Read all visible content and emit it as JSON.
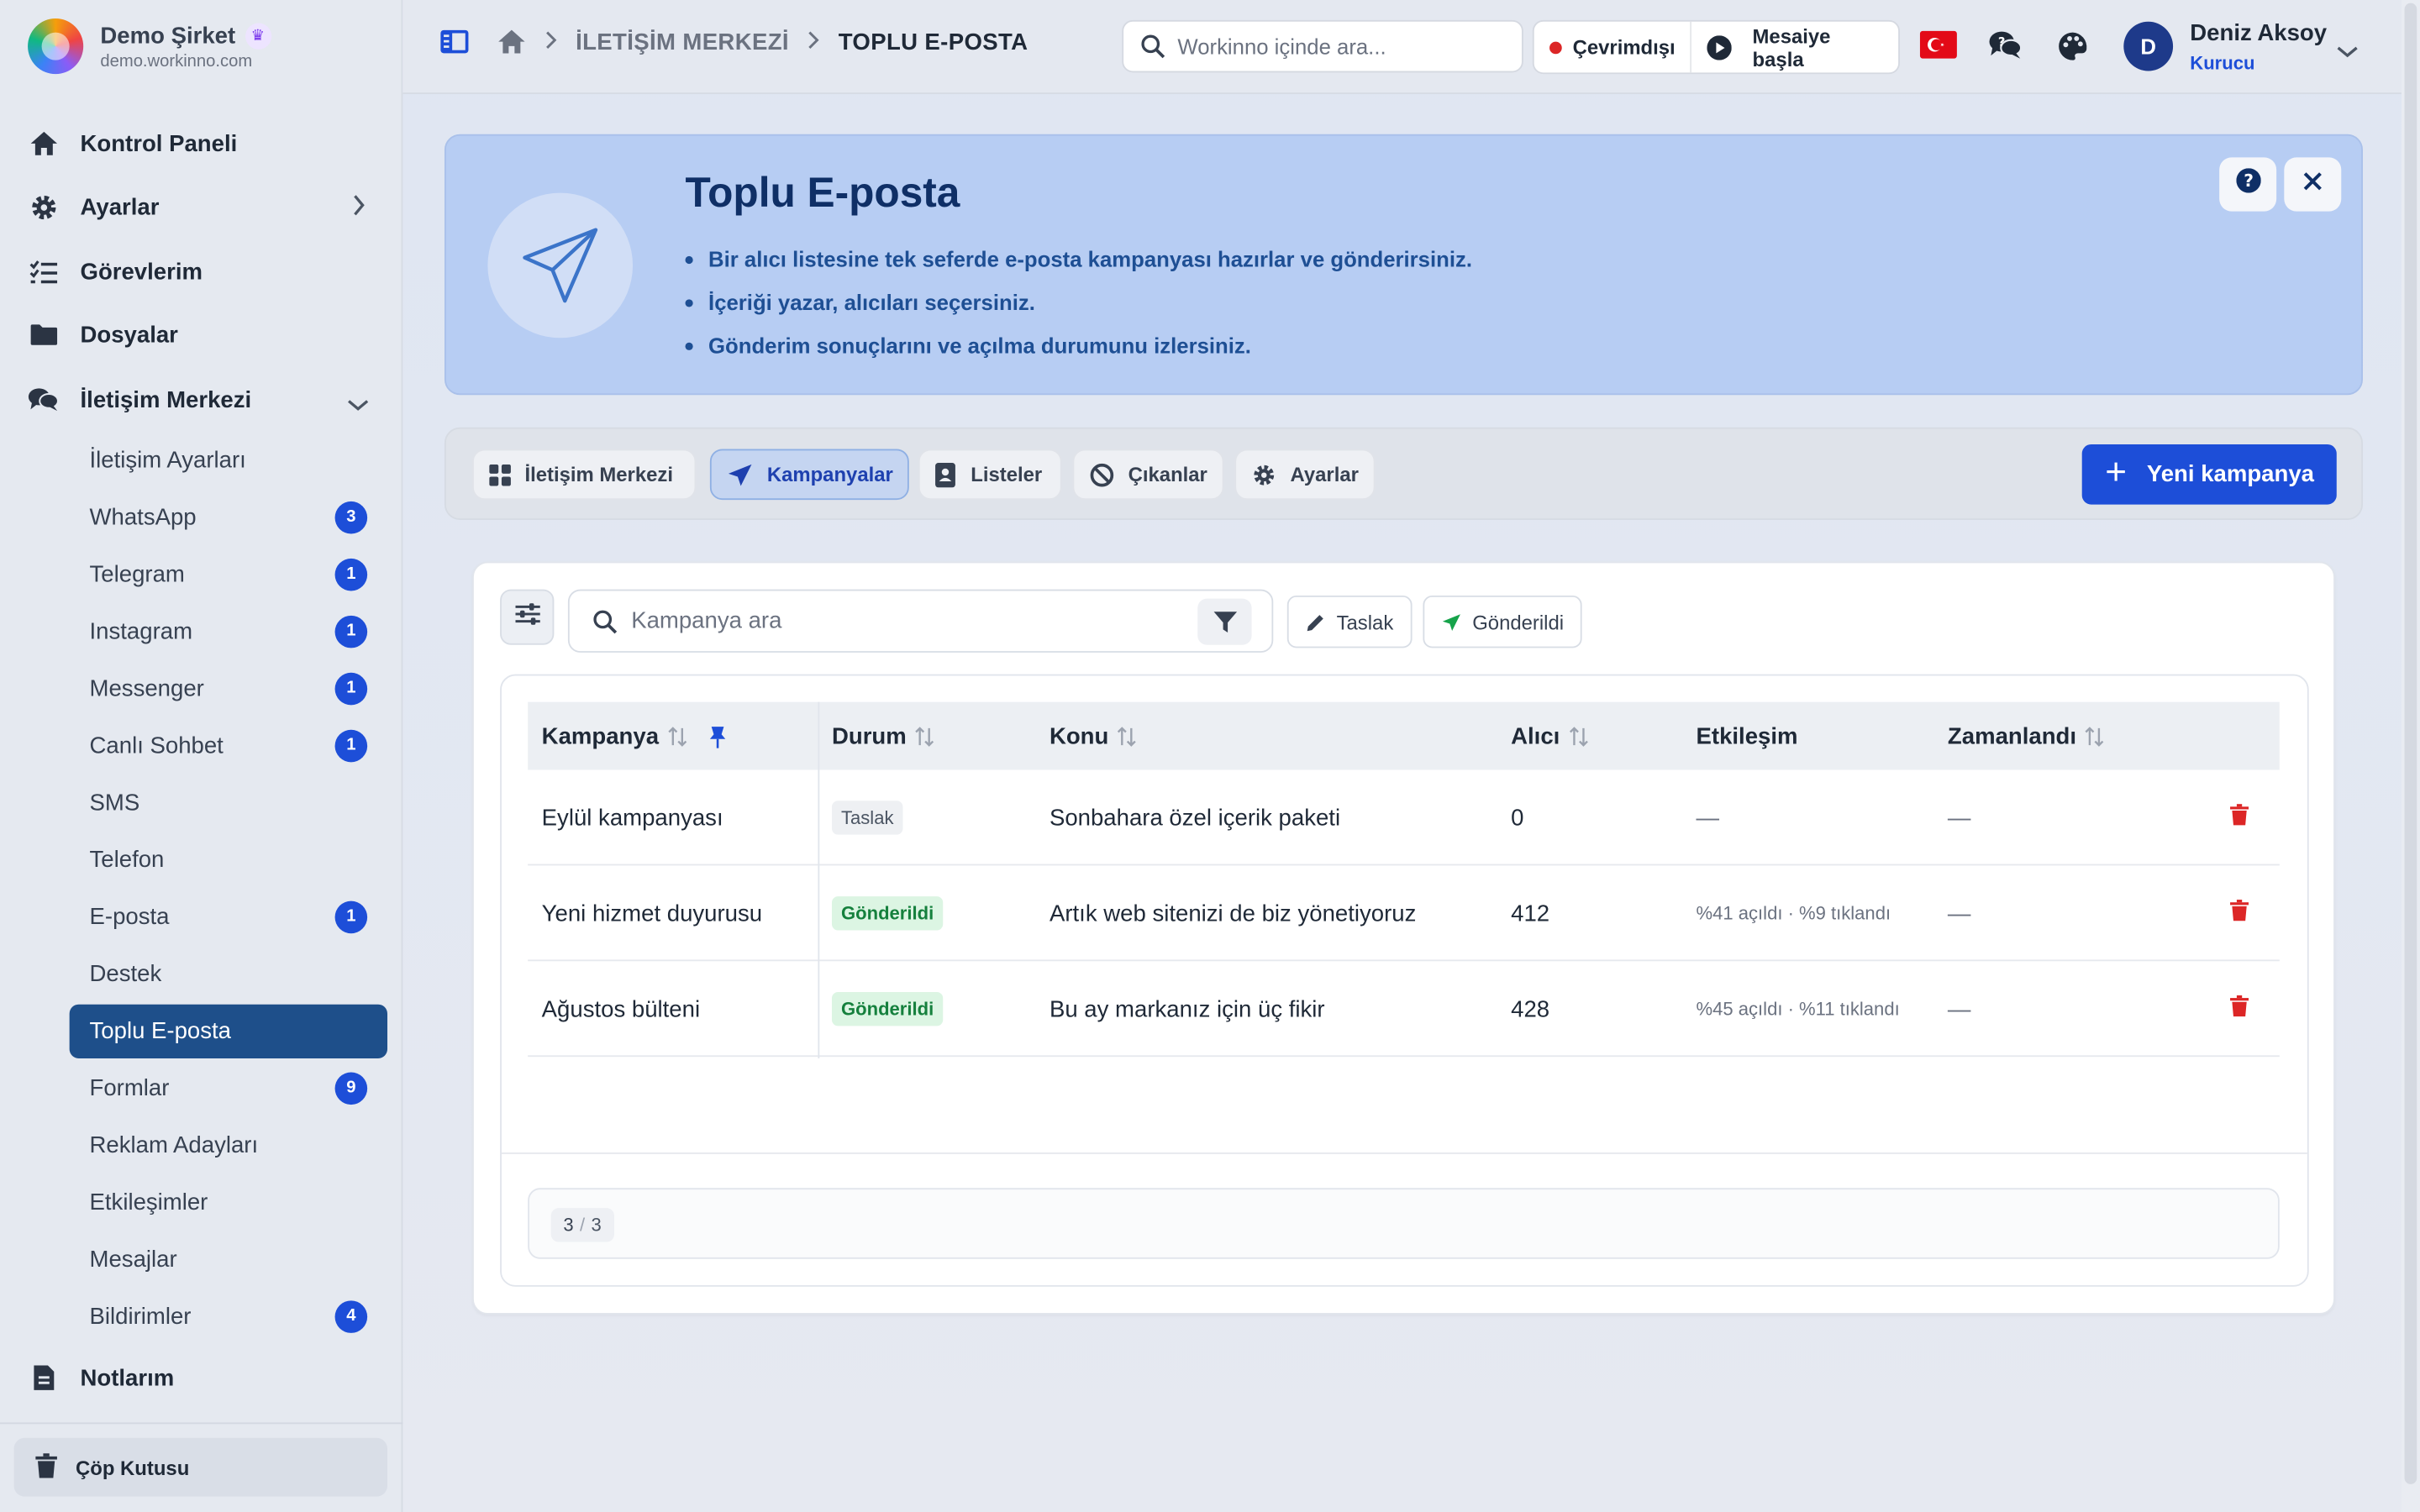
{
  "brand": {
    "name": "Demo Şirket",
    "url": "demo.workinno.com",
    "crown_icon": "crown-icon"
  },
  "sidebar": {
    "main_items": [
      {
        "label": "Kontrol Paneli",
        "icon": "home-icon"
      },
      {
        "label": "Ayarlar",
        "icon": "gear-icon"
      },
      {
        "label": "Görevlerim",
        "icon": "task-list-icon"
      },
      {
        "label": "Dosyalar",
        "icon": "folder-icon"
      },
      {
        "label": "İletişim Merkezi",
        "icon": "chat-icon"
      },
      {
        "label": "Notlarım",
        "icon": "note-icon"
      }
    ],
    "sub_items": [
      {
        "label": "İletişim Ayarları",
        "badge": null
      },
      {
        "label": "WhatsApp",
        "badge": "3"
      },
      {
        "label": "Telegram",
        "badge": "1"
      },
      {
        "label": "Instagram",
        "badge": "1"
      },
      {
        "label": "Messenger",
        "badge": "1"
      },
      {
        "label": "Canlı Sohbet",
        "badge": "1"
      },
      {
        "label": "SMS",
        "badge": null
      },
      {
        "label": "Telefon",
        "badge": null
      },
      {
        "label": "E-posta",
        "badge": "1"
      },
      {
        "label": "Destek",
        "badge": null
      },
      {
        "label": "Toplu E-posta",
        "badge": null,
        "active": true
      },
      {
        "label": "Formlar",
        "badge": "9"
      },
      {
        "label": "Reklam Adayları",
        "badge": null
      },
      {
        "label": "Etkileşimler",
        "badge": null
      },
      {
        "label": "Mesajlar",
        "badge": null
      },
      {
        "label": "Bildirimler",
        "badge": "4"
      }
    ],
    "trash_label": "Çöp Kutusu"
  },
  "topbar": {
    "breadcrumb": [
      "İLETİŞİM MERKEZİ",
      "TOPLU E-POSTA"
    ],
    "search_placeholder": "Workinno içinde ara...",
    "status_label": "Çevrimdışı",
    "shift_label": "Mesaiye başla",
    "user": {
      "initial": "D",
      "name": "Deniz Aksoy",
      "role": "Kurucu"
    }
  },
  "hero": {
    "title": "Toplu E-posta",
    "bullets": [
      "Bir alıcı listesine tek seferde e-posta kampanyası hazırlar ve gönderirsiniz.",
      "İçeriği yazar, alıcıları seçersiniz.",
      "Gönderim sonuçlarını ve açılma durumunu izlersiniz."
    ]
  },
  "tabs": [
    {
      "label": "İletişim Merkezi",
      "icon": "grid-icon"
    },
    {
      "label": "Kampanyalar",
      "icon": "send-icon",
      "active": true
    },
    {
      "label": "Listeler",
      "icon": "contact-book-icon"
    },
    {
      "label": "Çıkanlar",
      "icon": "ban-icon"
    },
    {
      "label": "Ayarlar",
      "icon": "gear-icon"
    }
  ],
  "new_campaign_label": "Yeni kampanya",
  "campaigns": {
    "search_placeholder": "Kampanya ara",
    "chips": [
      "Taslak",
      "Gönderildi"
    ],
    "columns": [
      "Kampanya",
      "Durum",
      "Konu",
      "Alıcı",
      "Etkileşim",
      "Zamanlandı"
    ],
    "rows": [
      {
        "name": "Eylül kampanyası",
        "status": "Taslak",
        "subject": "Sonbahara özel içerik paketi",
        "recipients": "0",
        "engagement": "—",
        "scheduled": "—"
      },
      {
        "name": "Yeni hizmet duyurusu",
        "status": "Gönderildi",
        "subject": "Artık web sitenizi de biz yönetiyoruz",
        "recipients": "412",
        "engagement": "%41 açıldı · %9 tıklandı",
        "scheduled": "—"
      },
      {
        "name": "Ağustos bülteni",
        "status": "Gönderildi",
        "subject": "Bu ay markanız için üç fikir",
        "recipients": "428",
        "engagement": "%45 açıldı · %11 tıklandı",
        "scheduled": "—"
      }
    ],
    "pagination": {
      "shown": "3",
      "total": "3"
    }
  },
  "colors": {
    "primary": "#1d4ed8",
    "active_nav": "#1e4f8a",
    "hero_bg": "#b7cdf3",
    "sent_green": "#15803d",
    "delete_red": "#dc2626",
    "offline_red": "#dc2626"
  }
}
